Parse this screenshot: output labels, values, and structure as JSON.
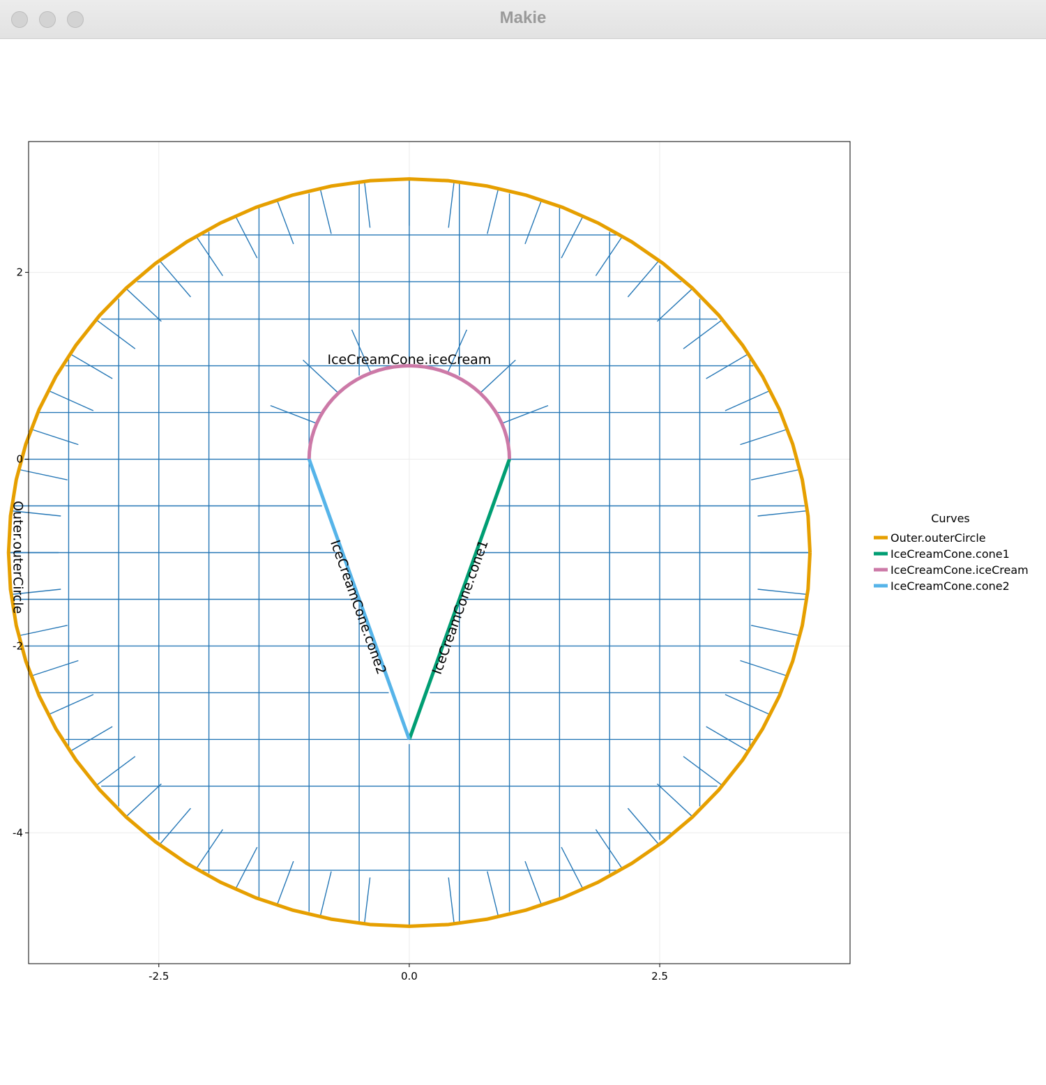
{
  "window": {
    "title": "Makie"
  },
  "chart_data": {
    "type": "line",
    "title": "",
    "xlabel": "",
    "ylabel": "",
    "xlim": [
      -3.8,
      4.4
    ],
    "ylim": [
      -5.4,
      3.4
    ],
    "aspect": "equal",
    "grid": true,
    "xticks": [
      -2.5,
      0.0,
      2.5
    ],
    "xtick_labels": [
      "-2.5",
      "0.0",
      "2.5"
    ],
    "yticks": [
      2,
      0,
      -2,
      -4
    ],
    "ytick_labels": [
      "2",
      "0",
      "-2",
      "-4"
    ],
    "legend": {
      "title": "Curves",
      "position": "right",
      "entries": [
        {
          "name": "Outer.outerCircle",
          "color": "#E69F00"
        },
        {
          "name": "IceCreamCone.cone1",
          "color": "#009E73"
        },
        {
          "name": "IceCreamCone.iceCream",
          "color": "#CC79A7"
        },
        {
          "name": "IceCreamCone.cone2",
          "color": "#56B4E9"
        }
      ]
    },
    "curves": [
      {
        "name": "Outer.outerCircle",
        "kind": "circle",
        "center": [
          0.0,
          -1.0
        ],
        "radius": 4.0,
        "color": "#E69F00"
      },
      {
        "name": "IceCreamCone.cone1",
        "kind": "segment",
        "from": [
          1.0,
          0.0
        ],
        "to": [
          0.0,
          -3.0
        ],
        "color": "#009E73"
      },
      {
        "name": "IceCreamCone.iceCream",
        "kind": "arc",
        "center": [
          0.0,
          0.0
        ],
        "radius": 1.0,
        "from_deg": 0,
        "to_deg": 180,
        "color": "#CC79A7"
      },
      {
        "name": "IceCreamCone.cone2",
        "kind": "segment",
        "from": [
          0.0,
          -3.0
        ],
        "to": [
          -1.0,
          0.0
        ],
        "color": "#56B4E9"
      }
    ],
    "curve_labels": [
      "IceCreamCone.iceCream",
      "IceCreamCone.cone2",
      "IceCreamCone.cone1",
      "Outer.outerCircle"
    ],
    "mesh": {
      "color": "#2577B6",
      "columns_x": [
        -3.4,
        -2.9,
        -2.5,
        -2.0,
        -1.5,
        -1.0,
        -0.5,
        0.0,
        0.5,
        1.0,
        1.5,
        2.0,
        2.5,
        2.9,
        3.4
      ],
      "rows_y": [
        2.4,
        1.9,
        1.5,
        1.0,
        0.5,
        0.0,
        -0.5,
        -1.0,
        -1.5,
        -2.0,
        -2.5,
        -3.0,
        -3.5,
        -4.0,
        -4.4
      ]
    }
  }
}
